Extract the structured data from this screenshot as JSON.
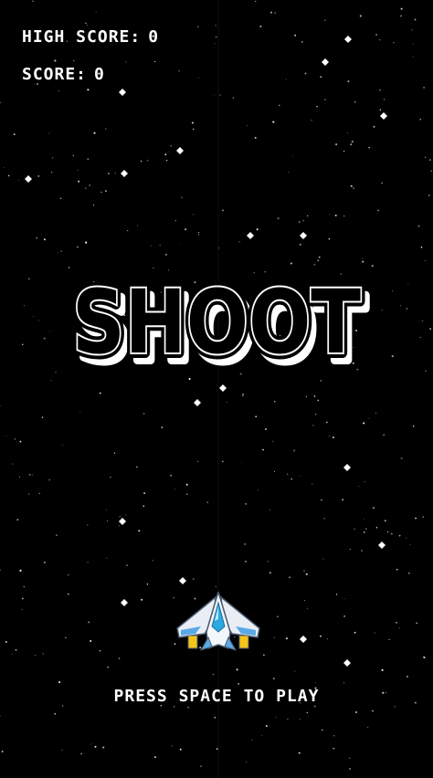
{
  "hud": {
    "high_score_label": "HIGH SCORE:",
    "high_score_value": "0",
    "score_label": "SCORE:",
    "score_value": "0"
  },
  "title": "SHOOT",
  "prompt": "PRESS SPACE TO PLAY",
  "player": {
    "icon": "spaceship-icon",
    "colors": {
      "hull": "#e9eef5",
      "cockpit": "#29a9e0",
      "wing_trim": "#5aa9e6",
      "engine": "#f5c518"
    }
  },
  "colors": {
    "background": "#000000",
    "text": "#ffffff"
  }
}
